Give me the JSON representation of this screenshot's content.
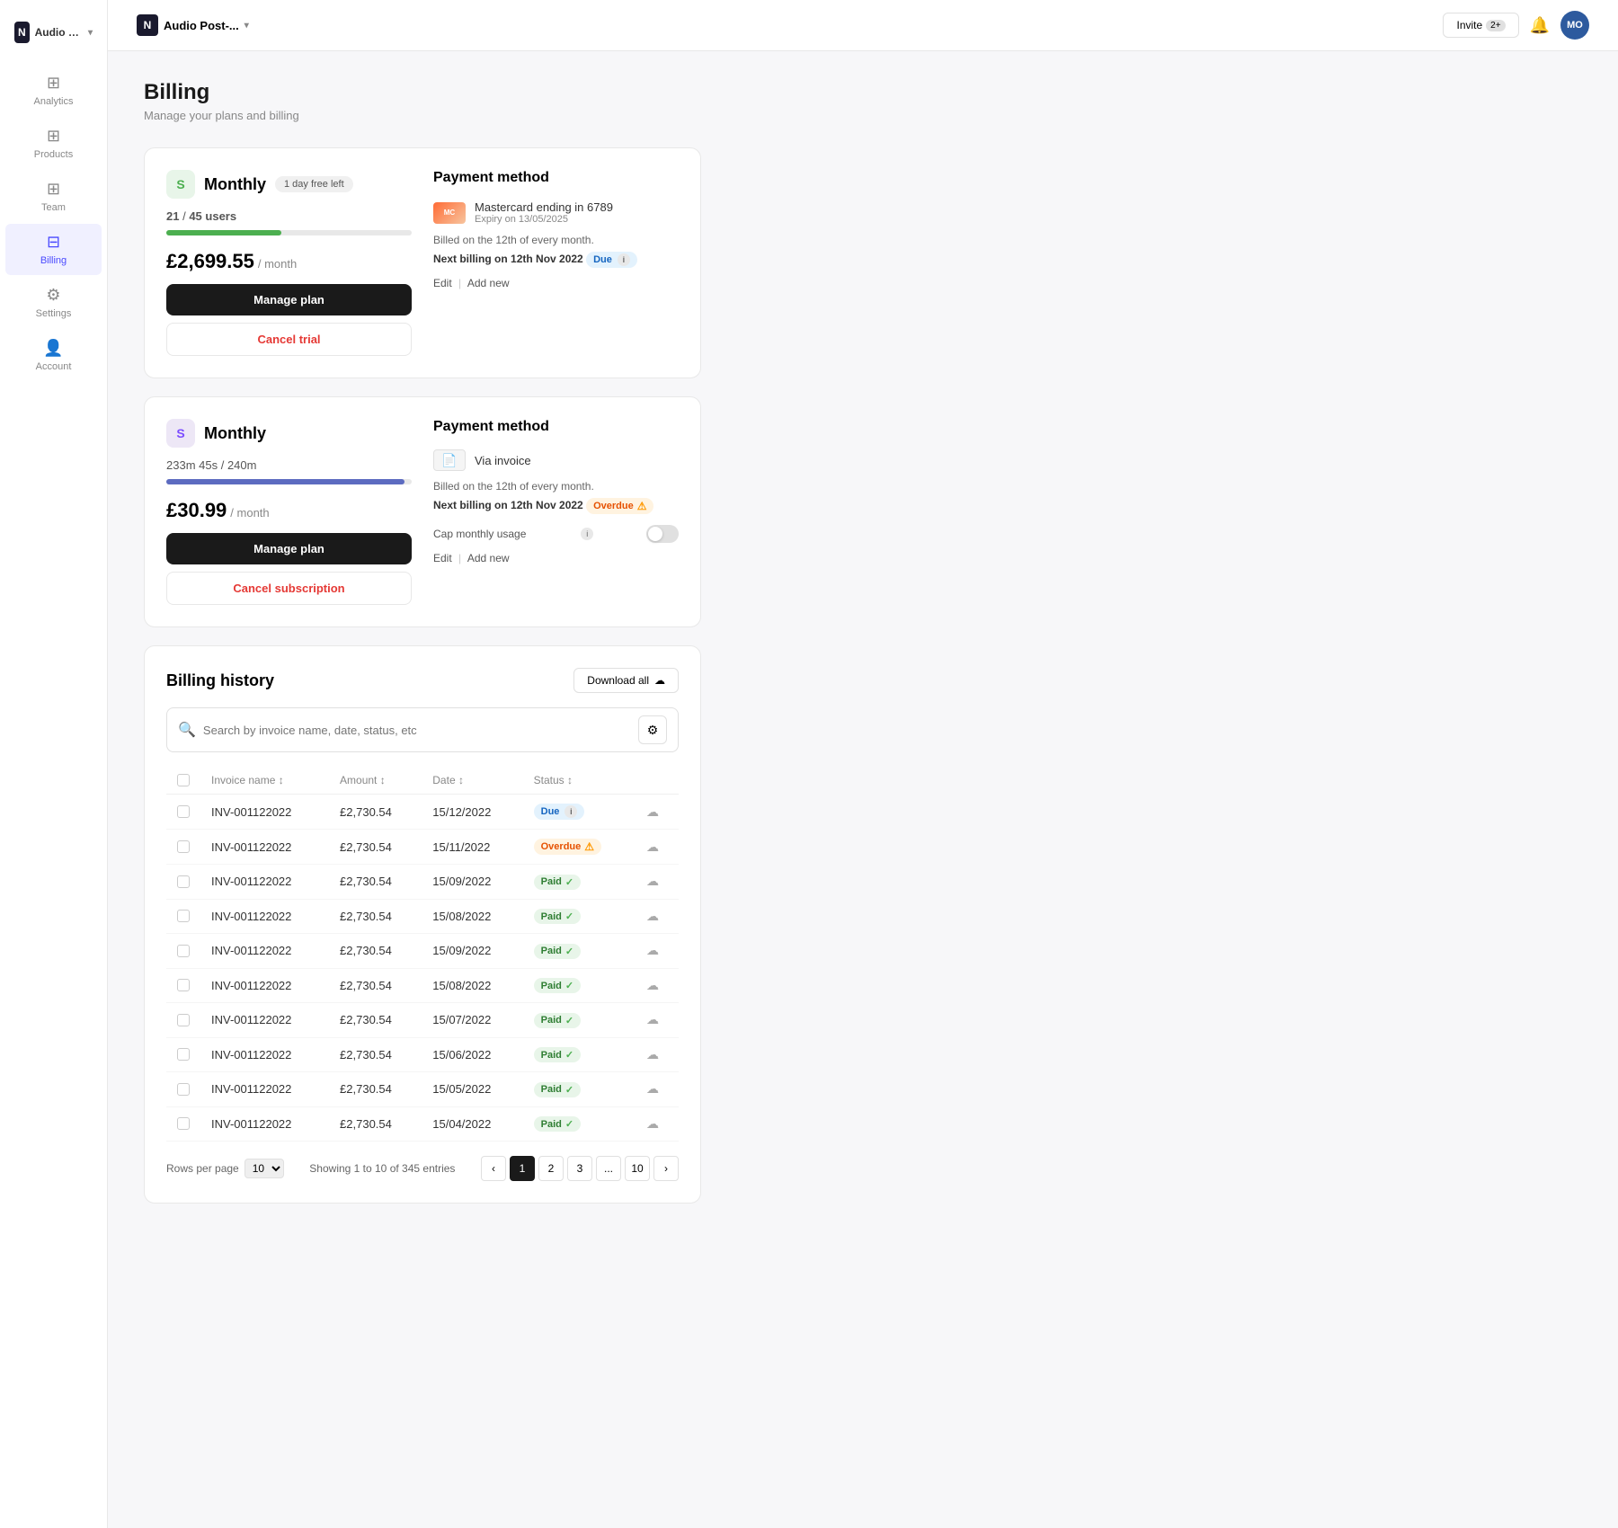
{
  "app": {
    "workspace_name": "Audio Post-...",
    "logo_letter": "N",
    "invite_label": "Invite",
    "invite_count": "2+",
    "avatar_initials": "MO"
  },
  "sidebar": {
    "items": [
      {
        "id": "analytics",
        "label": "Analytics",
        "icon": "⊞"
      },
      {
        "id": "products",
        "label": "Products",
        "icon": "⊞"
      },
      {
        "id": "team",
        "label": "Team",
        "icon": "⊞"
      },
      {
        "id": "billing",
        "label": "Billing",
        "icon": "⊟",
        "active": true
      },
      {
        "id": "settings",
        "label": "Settings",
        "icon": "⚙"
      },
      {
        "id": "account",
        "label": "Account",
        "icon": "👤"
      }
    ]
  },
  "page": {
    "title": "Billing",
    "subtitle": "Manage your plans and billing"
  },
  "plan_clarity": {
    "icon_emoji": "S",
    "name": "Monthly",
    "trial_badge": "1 day free left",
    "users_current": "21",
    "users_total": "45",
    "users_label": "users",
    "price": "£2,699.55",
    "price_period": "/ month",
    "progress_width": "47",
    "manage_label": "Manage plan",
    "cancel_label": "Cancel trial"
  },
  "payment_clarity": {
    "title": "Payment method",
    "card_label": "Mastercard ending in 6789",
    "card_expiry": "Expiry on 13/05/2025",
    "billing_text": "Billed on the 12th of every month.",
    "next_billing_text": "Next billing on",
    "next_billing_date": "12th Nov 2022",
    "status": "Due",
    "edit_label": "Edit",
    "add_new_label": "Add new"
  },
  "plan_monthly": {
    "icon_emoji": "S",
    "name": "Monthly",
    "storage_current": "233m 45s",
    "storage_total": "240m",
    "price": "£30.99",
    "price_period": "/ month",
    "progress_width": "97",
    "manage_label": "Manage plan",
    "cancel_label": "Cancel subscription"
  },
  "payment_monthly": {
    "title": "Payment method",
    "invoice_label": "Via invoice",
    "billing_text": "Billed on the 12th of every month.",
    "next_billing_text": "Next billing on",
    "next_billing_date": "12th Nov 2022",
    "status": "Overdue",
    "cap_monthly_usage_label": "Cap monthly usage",
    "edit_label": "Edit",
    "add_new_label": "Add new"
  },
  "billing_history": {
    "title": "Billing history",
    "download_all_label": "Download all",
    "search_placeholder": "Search by invoice name, date, status, etc",
    "columns": [
      "Invoice name",
      "Amount",
      "Date",
      "Status"
    ],
    "rows": [
      {
        "id": "INV-001122022",
        "amount": "£2,730.54",
        "date": "15/12/2022",
        "status": "Due"
      },
      {
        "id": "INV-001122022",
        "amount": "£2,730.54",
        "date": "15/11/2022",
        "status": "Overdue"
      },
      {
        "id": "INV-001122022",
        "amount": "£2,730.54",
        "date": "15/09/2022",
        "status": "Paid"
      },
      {
        "id": "INV-001122022",
        "amount": "£2,730.54",
        "date": "15/08/2022",
        "status": "Paid"
      },
      {
        "id": "INV-001122022",
        "amount": "£2,730.54",
        "date": "15/09/2022",
        "status": "Paid"
      },
      {
        "id": "INV-001122022",
        "amount": "£2,730.54",
        "date": "15/08/2022",
        "status": "Paid"
      },
      {
        "id": "INV-001122022",
        "amount": "£2,730.54",
        "date": "15/07/2022",
        "status": "Paid"
      },
      {
        "id": "INV-001122022",
        "amount": "£2,730.54",
        "date": "15/06/2022",
        "status": "Paid"
      },
      {
        "id": "INV-001122022",
        "amount": "£2,730.54",
        "date": "15/05/2022",
        "status": "Paid"
      },
      {
        "id": "INV-001122022",
        "amount": "£2,730.54",
        "date": "15/04/2022",
        "status": "Paid"
      }
    ],
    "rows_per_page": "10",
    "showing_text": "Showing 1 to 10 of 345 entries",
    "current_page": 1,
    "pages": [
      "1",
      "2",
      "3",
      "...",
      "10"
    ]
  }
}
